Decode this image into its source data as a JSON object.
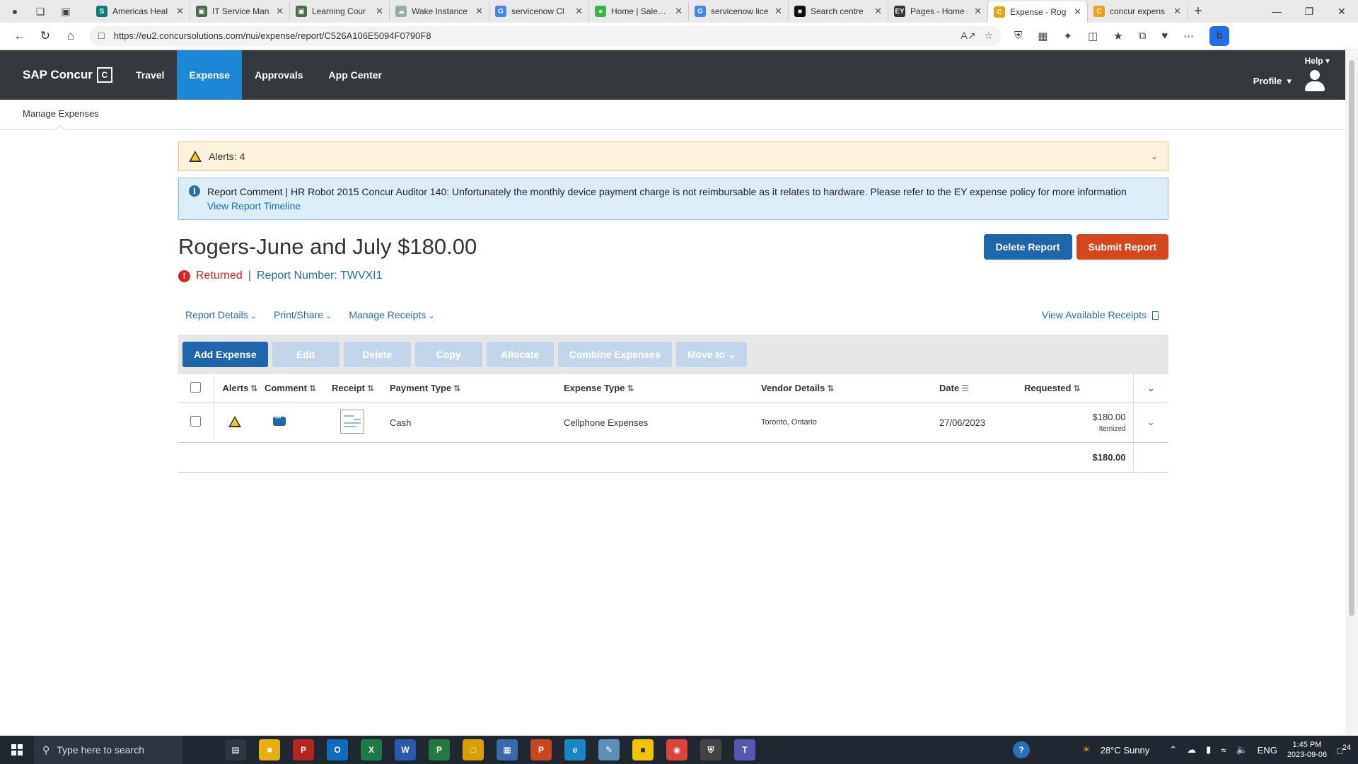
{
  "browser": {
    "tabs": [
      {
        "title": "Americas Heal",
        "favicon": "S",
        "color": "#0a7f73",
        "active": false
      },
      {
        "title": "IT Service Man",
        "favicon": "▣",
        "color": "#4a6b4a",
        "active": false
      },
      {
        "title": "Learning Cour",
        "favicon": "▣",
        "color": "#4a6b4a",
        "active": false
      },
      {
        "title": "Wake Instance",
        "favicon": "☁",
        "color": "#9aa",
        "active": false
      },
      {
        "title": "servicenow Cl",
        "favicon": "G",
        "color": "#4285f4",
        "active": false
      },
      {
        "title": "Home | Sales S",
        "favicon": "●",
        "color": "#3bb54a",
        "active": false
      },
      {
        "title": "servicenow lice",
        "favicon": "G",
        "color": "#4285f4",
        "active": false
      },
      {
        "title": "Search centre",
        "favicon": "■",
        "color": "#111",
        "active": false
      },
      {
        "title": "Pages - Home",
        "favicon": "EY",
        "color": "#333",
        "active": false
      },
      {
        "title": "Expense - Rog",
        "favicon": "C",
        "color": "#e8a317",
        "active": true
      },
      {
        "title": "concur expens",
        "favicon": "C",
        "color": "#e8a317",
        "active": false
      }
    ],
    "url": "https://eu2.concursolutions.com/nui/expense/report/C526A106E5094F0790F8"
  },
  "header": {
    "brand": "SAP Concur",
    "nav": [
      {
        "label": "Travel",
        "active": false
      },
      {
        "label": "Expense",
        "active": true
      },
      {
        "label": "Approvals",
        "active": false
      },
      {
        "label": "App Center",
        "active": false
      }
    ],
    "help": "Help",
    "profile": "Profile"
  },
  "subnav": {
    "label": "Manage Expenses"
  },
  "alerts": {
    "label": "Alerts: 4"
  },
  "report_comment": {
    "text": "Report Comment | HR Robot 2015 Concur Auditor 140: Unfortunately the monthly device payment charge is not reimbursable as it relates to hardware. Please refer to the EY expense policy for more information",
    "link": "View Report Timeline"
  },
  "report": {
    "title": "Rogers-June and July $180.00",
    "status": "Returned",
    "separator": "|",
    "number": "Report Number: TWVXI1",
    "delete_label": "Delete Report",
    "submit_label": "Submit Report"
  },
  "actions": {
    "report_details": "Report Details",
    "print_share": "Print/Share",
    "manage_receipts": "Manage Receipts",
    "view_receipts": "View Available Receipts"
  },
  "toolbar": {
    "add": "Add Expense",
    "edit": "Edit",
    "delete": "Delete",
    "copy": "Copy",
    "allocate": "Allocate",
    "combine": "Combine Expenses",
    "move": "Move to"
  },
  "table": {
    "columns": {
      "alerts": "Alerts",
      "comment": "Comment",
      "receipt": "Receipt",
      "payment": "Payment Type",
      "expense": "Expense Type",
      "vendor": "Vendor Details",
      "date": "Date",
      "requested": "Requested"
    },
    "rows": [
      {
        "payment": "Cash",
        "expense": "Cellphone Expenses",
        "vendor": "Toronto, Ontario",
        "date": "27/06/2023",
        "amount": "$180.00",
        "note": "Itemized"
      }
    ],
    "total": "$180.00"
  },
  "taskbar": {
    "search_placeholder": "Type here to search",
    "weather": "28°C  Sunny",
    "lang": "ENG",
    "time": "1:45 PM",
    "date": "2023-09-06",
    "notifications": "24"
  },
  "colors": {
    "header_bg": "#34393e",
    "accent": "#1e88d6",
    "primary_btn": "#1f67ad",
    "submit_btn": "#d6461c",
    "returned": "#c8291f"
  }
}
